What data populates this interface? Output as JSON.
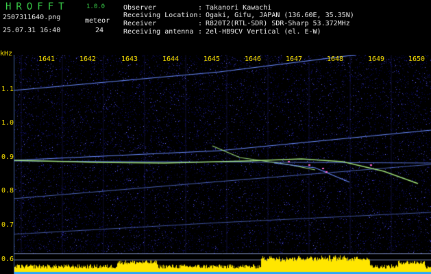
{
  "header": {
    "app_title": "HROFFT",
    "version": "1.0.0",
    "filename": "2507311640.png",
    "datetime": "25.07.31 16:40",
    "meteor_label": "meteor",
    "meteor_count": "24"
  },
  "info": [
    {
      "key": "Observer",
      "value": "Takanori Kawachi"
    },
    {
      "key": "Receiving Location",
      "value": "Ogaki, Gifu, JAPAN (136.60E, 35.35N)"
    },
    {
      "key": "Receiver",
      "value": "R820T2(RTL-SDR) SDR-Sharp 53.372MHz"
    },
    {
      "key": "Receiving antenna",
      "value": "2el-HB9CV Vertical (el. E-W)"
    }
  ],
  "axis": {
    "unit": "kHz",
    "y_ticks": [
      "1.1",
      "1.0",
      "0.9",
      "0.8",
      "0.7",
      "0.6"
    ],
    "x_ticks": [
      "1641",
      "1642",
      "1643",
      "1644",
      "1645",
      "1646",
      "1647",
      "1648",
      "1649",
      "1650"
    ]
  },
  "colors": {
    "background": "#000000",
    "noise_dark": "#0a0a5a",
    "noise_light": "#3b3bbf",
    "trace": "#6a8cff",
    "trace_hot": "#9fe07a",
    "meteor": "#ff66cc",
    "power": "#ffe600",
    "power_base": "#2aa7ff",
    "label_green": "#3ad14a",
    "label_yellow": "#ffe600"
  }
}
